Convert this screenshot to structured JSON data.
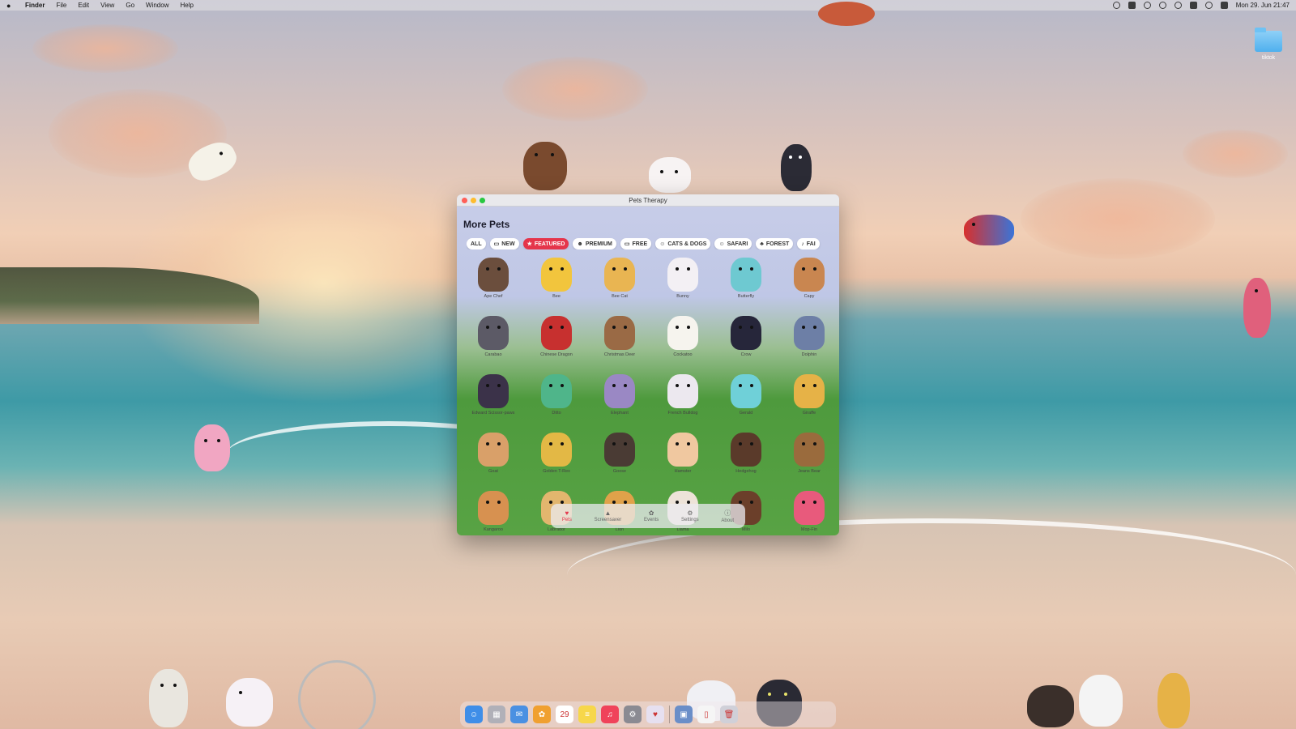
{
  "menubar": {
    "app_name": "Finder",
    "menus": [
      "File",
      "Edit",
      "View",
      "Go",
      "Window",
      "Help"
    ],
    "clock": "Mon 29. Jun 21:47"
  },
  "desktop": {
    "folder_label": "tiktok"
  },
  "window": {
    "title": "Pets Therapy",
    "heading": "More Pets",
    "filters": [
      {
        "label": "ALL",
        "icon": ""
      },
      {
        "label": "NEW",
        "icon": "▭"
      },
      {
        "label": "FEATURED",
        "icon": "★"
      },
      {
        "label": "PREMIUM",
        "icon": "☻"
      },
      {
        "label": "FREE",
        "icon": "▭"
      },
      {
        "label": "CATS & DOGS",
        "icon": "☺"
      },
      {
        "label": "SAFARI",
        "icon": "☺"
      },
      {
        "label": "FOREST",
        "icon": "♣"
      },
      {
        "label": "FAI",
        "icon": "♪"
      }
    ],
    "pets": [
      {
        "name": "Ape Chef",
        "color": "#6b4e3d"
      },
      {
        "name": "Bee",
        "color": "#f2c53d"
      },
      {
        "name": "Bee Cat",
        "color": "#e9b552"
      },
      {
        "name": "Bunny",
        "color": "#f3f0f4"
      },
      {
        "name": "Butterfly",
        "color": "#6ec9d1"
      },
      {
        "name": "Capy",
        "color": "#c98650"
      },
      {
        "name": "Carabao",
        "color": "#5c5a66"
      },
      {
        "name": "Chinese Dragon",
        "color": "#c7302f"
      },
      {
        "name": "Christmas Deer",
        "color": "#9a6a45"
      },
      {
        "name": "Cockatoo",
        "color": "#f6f4ee"
      },
      {
        "name": "Crow",
        "color": "#26263a"
      },
      {
        "name": "Dolphin",
        "color": "#6d7fa6"
      },
      {
        "name": "Edward Scissor-paws",
        "color": "#3b3249"
      },
      {
        "name": "Ditto",
        "color": "#4fb58a"
      },
      {
        "name": "Elephant",
        "color": "#9a88c4"
      },
      {
        "name": "French Bulldog",
        "color": "#ece8ef"
      },
      {
        "name": "Gerald",
        "color": "#6fd0d8"
      },
      {
        "name": "Giraffe",
        "color": "#e6b247"
      },
      {
        "name": "Goat",
        "color": "#d9a069"
      },
      {
        "name": "Golden T-Rex",
        "color": "#e3b845"
      },
      {
        "name": "Goose",
        "color": "#4a3b34"
      },
      {
        "name": "Hamster",
        "color": "#f0c8a0"
      },
      {
        "name": "Hedgehog",
        "color": "#5a3a2a"
      },
      {
        "name": "Jeans Bear",
        "color": "#9a6b3d"
      },
      {
        "name": "Kangaroo",
        "color": "#d79150"
      },
      {
        "name": "Labrador",
        "color": "#e2b66e"
      },
      {
        "name": "Lion",
        "color": "#e0a24a"
      },
      {
        "name": "Llama",
        "color": "#ede3d8"
      },
      {
        "name": "Milo",
        "color": "#6b3f2a"
      },
      {
        "name": "Mop-Fin",
        "color": "#e85a7c"
      }
    ],
    "tabs": [
      {
        "label": "Pets",
        "icon": "♥"
      },
      {
        "label": "Screensaver",
        "icon": "▲"
      },
      {
        "label": "Events",
        "icon": "✿"
      },
      {
        "label": "Settings",
        "icon": "⚙"
      },
      {
        "label": "About",
        "icon": "ⓘ"
      }
    ]
  },
  "dock": {
    "apps": [
      {
        "name": "finder",
        "color": "#3f8ee8",
        "glyph": "☺"
      },
      {
        "name": "launchpad",
        "color": "#b0b0b8",
        "glyph": "▦"
      },
      {
        "name": "mail",
        "color": "#4a90e2",
        "glyph": "✉"
      },
      {
        "name": "photos",
        "color": "#f0a030",
        "glyph": "✿"
      },
      {
        "name": "calendar",
        "color": "#ffffff",
        "glyph": "29"
      },
      {
        "name": "notes",
        "color": "#f7d74a",
        "glyph": "≡"
      },
      {
        "name": "music",
        "color": "#f0435a",
        "glyph": "♫"
      },
      {
        "name": "settings",
        "color": "#8a8a92",
        "glyph": "⚙"
      },
      {
        "name": "pets-therapy",
        "color": "#e6e0f0",
        "glyph": "♥"
      },
      {
        "name": "preview",
        "color": "#6a8ec8",
        "glyph": "▣"
      },
      {
        "name": "documents",
        "color": "#f5f5f5",
        "glyph": "▯"
      },
      {
        "name": "trash",
        "color": "#d0d0d8",
        "glyph": "🗑"
      }
    ]
  }
}
